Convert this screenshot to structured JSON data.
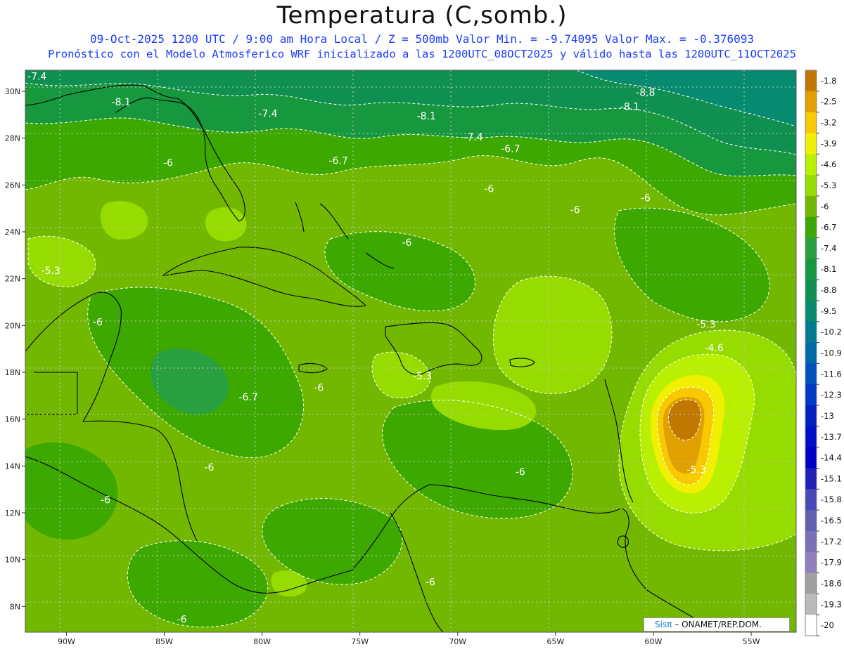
{
  "title": "Temperatura (C,somb.)",
  "subtitle_line1": "09-Oct-2025  1200 UTC / 9:00 am Hora Local / Z = 500mb  Valor Min. = -9.74095  Valor Max. = -0.376093",
  "subtitle_line2": "Pronóstico con el Modelo Atmosferico WRF inicializado a las 1200UTC_08OCT2025 y válido hasta las  1200UTC_11OCT2025",
  "credit": {
    "brand": "Sisπ",
    "text": " – ONAMET/REP.DOM."
  },
  "axes": {
    "lat_ticks": [
      "30N",
      "28N",
      "26N",
      "24N",
      "22N",
      "20N",
      "18N",
      "16N",
      "14N",
      "12N",
      "10N",
      "8N"
    ],
    "lon_ticks": [
      "90W",
      "85W",
      "80W",
      "75W",
      "70W",
      "65W",
      "60W",
      "55W"
    ]
  },
  "colorbar": {
    "labels": [
      "-1.8",
      "-2.5",
      "-3.2",
      "-3.9",
      "-4.6",
      "-5.3",
      "-6",
      "-6.7",
      "-7.4",
      "-8.1",
      "-8.8",
      "-9.5",
      "-10.2",
      "-10.9",
      "-11.6",
      "-12.3",
      "-13",
      "-13.7",
      "-14.4",
      "-15.1",
      "-15.8",
      "-16.5",
      "-17.2",
      "-17.9",
      "-18.6",
      "-19.3",
      "-20"
    ],
    "colors": [
      "#c07800",
      "#e0a000",
      "#f8c800",
      "#f0f000",
      "#b8f000",
      "#96dc00",
      "#72b800",
      "#3ca800",
      "#28a040",
      "#18983e",
      "#109050",
      "#068a70",
      "#007a90",
      "#006aa8",
      "#0050c0",
      "#0038c8",
      "#0020c0",
      "#0010c8",
      "#0000c8",
      "#2020b8",
      "#4848b8",
      "#6060b0",
      "#7a70b8",
      "#9080c0",
      "#a0a0a0",
      "#bababa",
      "#ffffff"
    ]
  },
  "contour_labels": [
    {
      "text": "-7.4",
      "lon": -91.5,
      "lat": 30.5
    },
    {
      "text": "-8.1",
      "lon": -87.2,
      "lat": 29.4
    },
    {
      "text": "-7.4",
      "lon": -79.7,
      "lat": 28.9
    },
    {
      "text": "-8.1",
      "lon": -71.6,
      "lat": 28.8
    },
    {
      "text": "-8.8",
      "lon": -60.4,
      "lat": 29.8
    },
    {
      "text": "-8.1",
      "lon": -61.2,
      "lat": 29.2
    },
    {
      "text": "-7.4",
      "lon": -69.2,
      "lat": 27.9
    },
    {
      "text": "-6.7",
      "lon": -76.1,
      "lat": 26.9
    },
    {
      "text": "-6.7",
      "lon": -67.3,
      "lat": 27.4
    },
    {
      "text": "-6",
      "lon": -84.8,
      "lat": 26.8
    },
    {
      "text": "-6",
      "lon": -68.4,
      "lat": 25.7
    },
    {
      "text": "-6",
      "lon": -64.0,
      "lat": 24.8
    },
    {
      "text": "-6",
      "lon": -60.4,
      "lat": 25.3
    },
    {
      "text": "-6",
      "lon": -72.6,
      "lat": 23.4
    },
    {
      "text": "-5.3",
      "lon": -90.8,
      "lat": 22.2
    },
    {
      "text": "-6",
      "lon": -88.4,
      "lat": 20.0
    },
    {
      "text": "-5.3",
      "lon": -57.3,
      "lat": 19.9
    },
    {
      "text": "-4.6",
      "lon": -56.9,
      "lat": 18.9
    },
    {
      "text": "-5.3",
      "lon": -71.8,
      "lat": 17.7
    },
    {
      "text": "-6",
      "lon": -77.1,
      "lat": 17.2
    },
    {
      "text": "-6.7",
      "lon": -80.7,
      "lat": 16.8
    },
    {
      "text": "-5.3",
      "lon": -57.8,
      "lat": 13.7
    },
    {
      "text": "-6",
      "lon": -66.8,
      "lat": 13.6
    },
    {
      "text": "-6",
      "lon": -82.7,
      "lat": 13.8
    },
    {
      "text": "-6",
      "lon": -88.0,
      "lat": 12.4
    },
    {
      "text": "-6",
      "lon": -71.4,
      "lat": 8.9
    },
    {
      "text": "-6",
      "lon": -84.1,
      "lat": 7.3
    }
  ]
}
